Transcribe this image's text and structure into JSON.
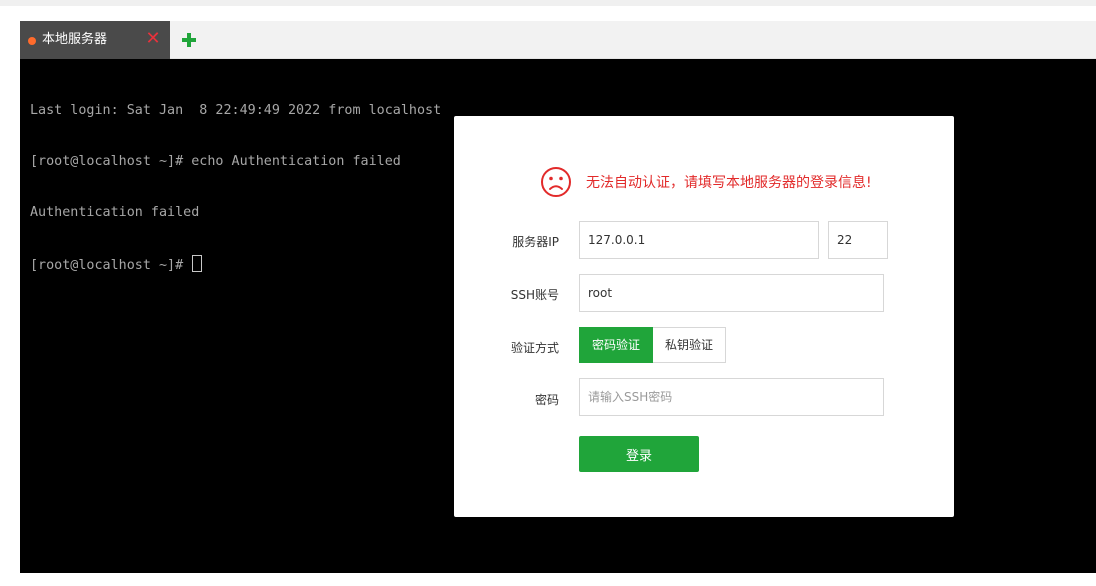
{
  "tabs": [
    {
      "label": "本地服务器",
      "status_color": "#ff6b2c"
    }
  ],
  "add_tab_icon": "plus-icon",
  "terminal": {
    "lines": [
      "Last login: Sat Jan  8 22:49:49 2022 from localhost",
      "[root@localhost ~]# echo Authentication failed",
      "Authentication failed",
      "[root@localhost ~]# "
    ]
  },
  "dialog": {
    "alert_icon": "sad-face-icon",
    "alert_text": "无法自动认证，请填写本地服务器的登录信息!",
    "server_ip_label": "服务器IP",
    "server_ip_value": "127.0.0.1",
    "port_value": "22",
    "ssh_account_label": "SSH账号",
    "ssh_account_value": "root",
    "auth_method_label": "验证方式",
    "auth_options": [
      "密码验证",
      "私钥验证"
    ],
    "selected_auth": "密码验证",
    "password_label": "密码",
    "password_placeholder": "请输入SSH密码",
    "login_label": "登录"
  },
  "colors": {
    "accent": "#20a53a",
    "error": "#e22a2a",
    "tab_close": "#e8323c"
  }
}
